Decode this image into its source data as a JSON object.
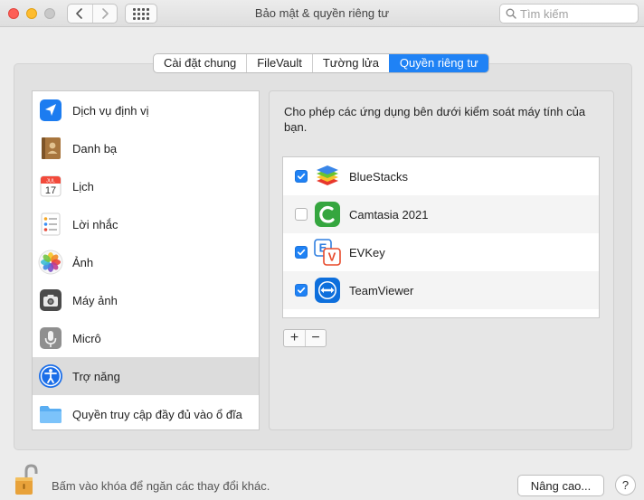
{
  "window": {
    "title": "Bảo mật & quyền riêng tư",
    "search_placeholder": "Tìm kiếm"
  },
  "tabs": [
    {
      "label": "Cài đặt chung",
      "active": false
    },
    {
      "label": "FileVault",
      "active": false
    },
    {
      "label": "Tường lửa",
      "active": false
    },
    {
      "label": "Quyền riêng tư",
      "active": true
    }
  ],
  "sidebar": {
    "items": [
      {
        "label": "Dịch vụ định vị",
        "icon": "location-arrow-icon"
      },
      {
        "label": "Danh bạ",
        "icon": "contacts-book-icon"
      },
      {
        "label": "Lịch",
        "icon": "calendar-icon",
        "icon_text": {
          "month": "JUL",
          "day": "17"
        }
      },
      {
        "label": "Lời nhắc",
        "icon": "reminders-icon"
      },
      {
        "label": "Ảnh",
        "icon": "photos-flower-icon"
      },
      {
        "label": "Máy ảnh",
        "icon": "camera-icon"
      },
      {
        "label": "Micrô",
        "icon": "microphone-icon"
      },
      {
        "label": "Trợ năng",
        "icon": "accessibility-icon",
        "selected": true
      },
      {
        "label": "Quyền truy cập đầy đủ vào ổ đĩa",
        "icon": "folder-icon"
      }
    ]
  },
  "content": {
    "description": "Cho phép các ứng dụng bên dưới kiểm soát máy tính của bạn.",
    "apps": [
      {
        "name": "BlueStacks",
        "checked": true,
        "icon": "bluestacks-icon"
      },
      {
        "name": "Camtasia 2021",
        "checked": false,
        "icon": "camtasia-icon"
      },
      {
        "name": "EVKey",
        "checked": true,
        "icon": "evkey-icon",
        "icon_text": {
          "top": "E",
          "bottom": "V"
        }
      },
      {
        "name": "TeamViewer",
        "checked": true,
        "icon": "teamviewer-icon"
      }
    ],
    "add_label": "+",
    "remove_label": "−"
  },
  "footer": {
    "lock_text": "Bấm vào khóa để ngăn các thay đổi khác.",
    "advanced_label": "Nâng cao...",
    "help_label": "?"
  },
  "colors": {
    "accent": "#1f82f5",
    "selected_row": "#dcdcdc",
    "window_bg": "#ececec"
  }
}
